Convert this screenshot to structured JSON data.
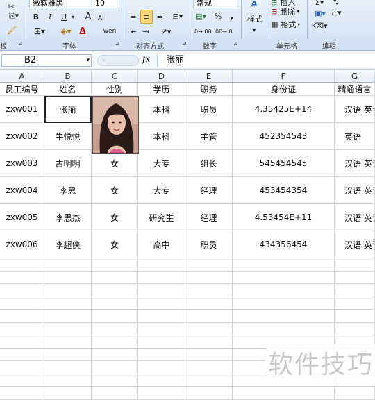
{
  "ribbon": {
    "font_name": "微软雅黑",
    "font_size": "10",
    "number_format": "常规",
    "style_label": "样式",
    "insert_label": "插入",
    "delete_label": "删除",
    "format_label": "格式",
    "groups": {
      "clipboard": "板",
      "font": "字体",
      "alignment": "对齐方式",
      "number": "数字",
      "cells": "单元格",
      "editing": "编辑"
    },
    "buttons": {
      "bold": "B",
      "italic": "I",
      "underline": "U",
      "grow_font": "A",
      "shrink_font": "A",
      "font_color": "A",
      "phonetic": "wén",
      "percent": "%",
      "comma": ",",
      "inc_decimal": ".0→.00",
      "dec_decimal": ".00→.0"
    }
  },
  "formula_bar": {
    "name_box": "B2",
    "fx": "fx",
    "value": "张丽"
  },
  "columns": [
    "A",
    "B",
    "C",
    "D",
    "E",
    "F",
    "G"
  ],
  "headers": [
    "员工编号",
    "姓名",
    "性别",
    "学历",
    "职务",
    "身份证",
    "精通语言"
  ],
  "rows": [
    [
      "zxw001",
      "张丽",
      "",
      "本科",
      "职员",
      "4.35425E+14",
      "汉语 英语"
    ],
    [
      "zxw002",
      "牛悦悦",
      "",
      "本科",
      "主管",
      "452354543",
      "英语"
    ],
    [
      "zxw003",
      "古明明",
      "女",
      "大专",
      "组长",
      "545454545",
      "汉语 英语"
    ],
    [
      "zxw004",
      "李思",
      "女",
      "大专",
      "经理",
      "453454354",
      "汉语 英语 法语"
    ],
    [
      "zxw005",
      "李思杰",
      "女",
      "研究生",
      "经理",
      "4.53454E+11",
      "汉语 英语 法语"
    ],
    [
      "zxw006",
      "李超侠",
      "女",
      "高中",
      "职员",
      "434356454",
      "汉语 英语"
    ]
  ],
  "watermark": "软件技巧",
  "colors": {
    "ribbon_bg": "#dde8f5",
    "grid_line": "#d4d4d4",
    "header_bg": "#e4ecf7"
  }
}
